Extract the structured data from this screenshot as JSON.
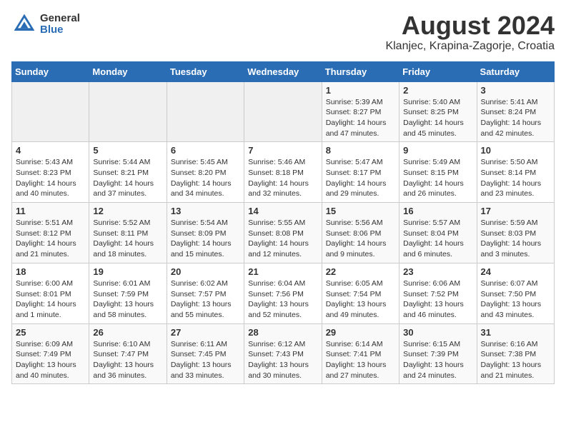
{
  "header": {
    "logo_general": "General",
    "logo_blue": "Blue",
    "month_year": "August 2024",
    "location": "Klanjec, Krapina-Zagorje, Croatia"
  },
  "calendar": {
    "days_of_week": [
      "Sunday",
      "Monday",
      "Tuesday",
      "Wednesday",
      "Thursday",
      "Friday",
      "Saturday"
    ],
    "weeks": [
      [
        {
          "day": "",
          "info": ""
        },
        {
          "day": "",
          "info": ""
        },
        {
          "day": "",
          "info": ""
        },
        {
          "day": "",
          "info": ""
        },
        {
          "day": "1",
          "info": "Sunrise: 5:39 AM\nSunset: 8:27 PM\nDaylight: 14 hours and 47 minutes."
        },
        {
          "day": "2",
          "info": "Sunrise: 5:40 AM\nSunset: 8:25 PM\nDaylight: 14 hours and 45 minutes."
        },
        {
          "day": "3",
          "info": "Sunrise: 5:41 AM\nSunset: 8:24 PM\nDaylight: 14 hours and 42 minutes."
        }
      ],
      [
        {
          "day": "4",
          "info": "Sunrise: 5:43 AM\nSunset: 8:23 PM\nDaylight: 14 hours and 40 minutes."
        },
        {
          "day": "5",
          "info": "Sunrise: 5:44 AM\nSunset: 8:21 PM\nDaylight: 14 hours and 37 minutes."
        },
        {
          "day": "6",
          "info": "Sunrise: 5:45 AM\nSunset: 8:20 PM\nDaylight: 14 hours and 34 minutes."
        },
        {
          "day": "7",
          "info": "Sunrise: 5:46 AM\nSunset: 8:18 PM\nDaylight: 14 hours and 32 minutes."
        },
        {
          "day": "8",
          "info": "Sunrise: 5:47 AM\nSunset: 8:17 PM\nDaylight: 14 hours and 29 minutes."
        },
        {
          "day": "9",
          "info": "Sunrise: 5:49 AM\nSunset: 8:15 PM\nDaylight: 14 hours and 26 minutes."
        },
        {
          "day": "10",
          "info": "Sunrise: 5:50 AM\nSunset: 8:14 PM\nDaylight: 14 hours and 23 minutes."
        }
      ],
      [
        {
          "day": "11",
          "info": "Sunrise: 5:51 AM\nSunset: 8:12 PM\nDaylight: 14 hours and 21 minutes."
        },
        {
          "day": "12",
          "info": "Sunrise: 5:52 AM\nSunset: 8:11 PM\nDaylight: 14 hours and 18 minutes."
        },
        {
          "day": "13",
          "info": "Sunrise: 5:54 AM\nSunset: 8:09 PM\nDaylight: 14 hours and 15 minutes."
        },
        {
          "day": "14",
          "info": "Sunrise: 5:55 AM\nSunset: 8:08 PM\nDaylight: 14 hours and 12 minutes."
        },
        {
          "day": "15",
          "info": "Sunrise: 5:56 AM\nSunset: 8:06 PM\nDaylight: 14 hours and 9 minutes."
        },
        {
          "day": "16",
          "info": "Sunrise: 5:57 AM\nSunset: 8:04 PM\nDaylight: 14 hours and 6 minutes."
        },
        {
          "day": "17",
          "info": "Sunrise: 5:59 AM\nSunset: 8:03 PM\nDaylight: 14 hours and 3 minutes."
        }
      ],
      [
        {
          "day": "18",
          "info": "Sunrise: 6:00 AM\nSunset: 8:01 PM\nDaylight: 14 hours and 1 minute."
        },
        {
          "day": "19",
          "info": "Sunrise: 6:01 AM\nSunset: 7:59 PM\nDaylight: 13 hours and 58 minutes."
        },
        {
          "day": "20",
          "info": "Sunrise: 6:02 AM\nSunset: 7:57 PM\nDaylight: 13 hours and 55 minutes."
        },
        {
          "day": "21",
          "info": "Sunrise: 6:04 AM\nSunset: 7:56 PM\nDaylight: 13 hours and 52 minutes."
        },
        {
          "day": "22",
          "info": "Sunrise: 6:05 AM\nSunset: 7:54 PM\nDaylight: 13 hours and 49 minutes."
        },
        {
          "day": "23",
          "info": "Sunrise: 6:06 AM\nSunset: 7:52 PM\nDaylight: 13 hours and 46 minutes."
        },
        {
          "day": "24",
          "info": "Sunrise: 6:07 AM\nSunset: 7:50 PM\nDaylight: 13 hours and 43 minutes."
        }
      ],
      [
        {
          "day": "25",
          "info": "Sunrise: 6:09 AM\nSunset: 7:49 PM\nDaylight: 13 hours and 40 minutes."
        },
        {
          "day": "26",
          "info": "Sunrise: 6:10 AM\nSunset: 7:47 PM\nDaylight: 13 hours and 36 minutes."
        },
        {
          "day": "27",
          "info": "Sunrise: 6:11 AM\nSunset: 7:45 PM\nDaylight: 13 hours and 33 minutes."
        },
        {
          "day": "28",
          "info": "Sunrise: 6:12 AM\nSunset: 7:43 PM\nDaylight: 13 hours and 30 minutes."
        },
        {
          "day": "29",
          "info": "Sunrise: 6:14 AM\nSunset: 7:41 PM\nDaylight: 13 hours and 27 minutes."
        },
        {
          "day": "30",
          "info": "Sunrise: 6:15 AM\nSunset: 7:39 PM\nDaylight: 13 hours and 24 minutes."
        },
        {
          "day": "31",
          "info": "Sunrise: 6:16 AM\nSunset: 7:38 PM\nDaylight: 13 hours and 21 minutes."
        }
      ]
    ]
  }
}
